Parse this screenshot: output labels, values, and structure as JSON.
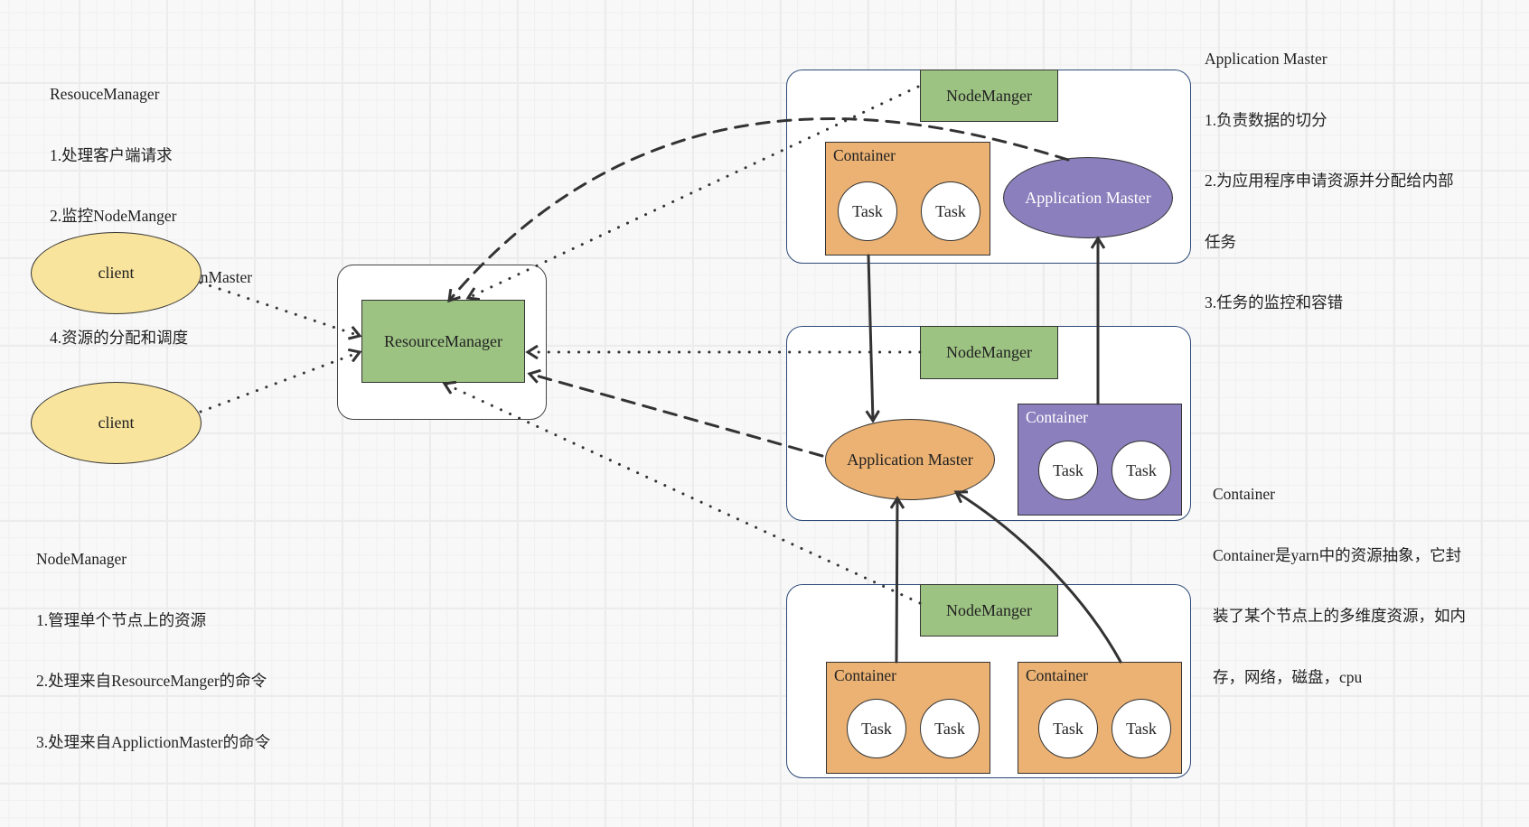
{
  "notes": {
    "resource_manager": {
      "title": "ResouceManager",
      "lines": [
        "1.处理客户端请求",
        "2.监控NodeManger",
        "3.启动或监控ApplictionMaster",
        "4.资源的分配和调度"
      ]
    },
    "application_master": {
      "title": "Application Master",
      "lines": [
        "1.负责数据的切分",
        "2.为应用程序申请资源并分配给内部",
        "任务",
        "3.任务的监控和容错"
      ]
    },
    "container": {
      "title": "Container",
      "lines": [
        "Container是yarn中的资源抽象，它封",
        "装了某个节点上的多维度资源，如内",
        "存，网络，磁盘，cpu"
      ]
    },
    "node_manager": {
      "title": "NodeManager",
      "lines": [
        "1.管理单个节点上的资源",
        "2.处理来自ResourceManger的命令",
        "3.处理来自ApplictionMaster的命令"
      ]
    }
  },
  "clients": [
    "client",
    "client"
  ],
  "resource_manager": {
    "label": "ResourceManager"
  },
  "nodes": [
    {
      "node_manager": "NodeManger",
      "application_master": "Application Master",
      "containers": [
        {
          "label": "Container",
          "tasks": [
            "Task",
            "Task"
          ]
        }
      ]
    },
    {
      "node_manager": "NodeManger",
      "application_master": "Application Master",
      "containers": [
        {
          "label": "Container",
          "tasks": [
            "Task",
            "Task"
          ]
        }
      ]
    },
    {
      "node_manager": "NodeManger",
      "containers": [
        {
          "label": "Container",
          "tasks": [
            "Task",
            "Task"
          ]
        },
        {
          "label": "Container",
          "tasks": [
            "Task",
            "Task"
          ]
        }
      ]
    }
  ],
  "colors": {
    "node_manager": "#9dc383",
    "container_orange": "#ebb273",
    "container_purple": "#8b7fbd",
    "client": "#f9e49d",
    "node_border": "#2c4a78"
  }
}
